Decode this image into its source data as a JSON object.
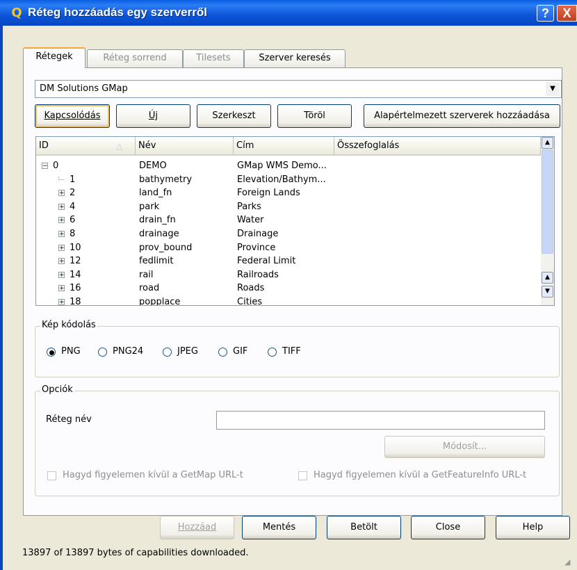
{
  "window": {
    "title": "Réteg hozzáadás egy szerverről",
    "help_label": "?",
    "close_label": "X"
  },
  "tabs": [
    {
      "label": "Rétegek",
      "active": true
    },
    {
      "label": "Réteg sorrend",
      "active": false
    },
    {
      "label": "Tilesets",
      "active": false
    },
    {
      "label": "Szerver keresés",
      "active": false
    }
  ],
  "server_combo": {
    "value": "DM Solutions GMap"
  },
  "connection_buttons": {
    "connect": "Kapcsolódás",
    "new": "Új",
    "edit": "Szerkeszt",
    "delete": "Töröl",
    "add_defaults": "Alapértelmezett szerverek hozzáadása"
  },
  "table": {
    "columns": [
      "ID",
      "Név",
      "Cím",
      "Összefoglalás"
    ],
    "rows": [
      {
        "id": "0",
        "name": "DEMO",
        "title": "GMap WMS Demo...",
        "summary": "",
        "expander": "−",
        "level": 0
      },
      {
        "id": "1",
        "name": "bathymetry",
        "title": "Elevation/Bathym...",
        "summary": "",
        "expander": "",
        "level": 1
      },
      {
        "id": "2",
        "name": "land_fn",
        "title": "Foreign Lands",
        "summary": "",
        "expander": "+",
        "level": 1
      },
      {
        "id": "4",
        "name": "park",
        "title": "Parks",
        "summary": "",
        "expander": "+",
        "level": 1
      },
      {
        "id": "6",
        "name": "drain_fn",
        "title": "Water",
        "summary": "",
        "expander": "+",
        "level": 1
      },
      {
        "id": "8",
        "name": "drainage",
        "title": "Drainage",
        "summary": "",
        "expander": "+",
        "level": 1
      },
      {
        "id": "10",
        "name": "prov_bound",
        "title": "Province",
        "summary": "",
        "expander": "+",
        "level": 1
      },
      {
        "id": "12",
        "name": "fedlimit",
        "title": "Federal Limit",
        "summary": "",
        "expander": "+",
        "level": 1
      },
      {
        "id": "14",
        "name": "rail",
        "title": "Railroads",
        "summary": "",
        "expander": "+",
        "level": 1
      },
      {
        "id": "16",
        "name": "road",
        "title": "Roads",
        "summary": "",
        "expander": "+",
        "level": 1
      },
      {
        "id": "18",
        "name": "popplace",
        "title": "Cities",
        "summary": "",
        "expander": "+",
        "level": 1
      }
    ]
  },
  "image_encoding": {
    "title": "Kép kódolás",
    "options": [
      "PNG",
      "PNG24",
      "JPEG",
      "GIF",
      "TIFF"
    ],
    "selected": "PNG"
  },
  "options": {
    "title": "Opciók",
    "layer_name_label": "Réteg név",
    "layer_name_value": "",
    "change_button": "Módosít...",
    "ignore_getmap": "Hagyd figyelemen kívül a GetMap URL-t",
    "ignore_getfeatureinfo": "Hagyd figyelemen kívül a GetFeatureInfo URL-t"
  },
  "bottom_buttons": {
    "add": "Hozzáad",
    "save": "Mentés",
    "load": "Betölt",
    "close": "Close",
    "help": "Help"
  },
  "status_text": "13897 of 13897 bytes of capabilities downloaded."
}
